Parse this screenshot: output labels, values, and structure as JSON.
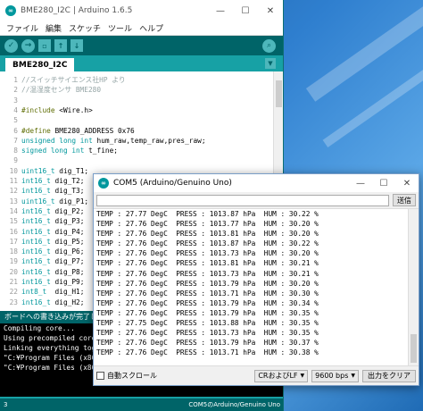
{
  "ide": {
    "title": "BME280_I2C | Arduino 1.6.5",
    "menu": [
      "ファイル",
      "編集",
      "スケッチ",
      "ツール",
      "ヘルプ"
    ],
    "tab_label": "BME280_I2C",
    "code_lines": [
      {
        "n": "1",
        "segs": [
          [
            "c",
            "//スイッチサイエンス社HP より"
          ]
        ]
      },
      {
        "n": "2",
        "segs": [
          [
            "c",
            "//温湿度センサ BME280"
          ]
        ]
      },
      {
        "n": "3",
        "segs": []
      },
      {
        "n": "4",
        "segs": [
          [
            "p",
            "#include"
          ],
          [
            "i",
            " <Wire.h>"
          ]
        ]
      },
      {
        "n": "5",
        "segs": []
      },
      {
        "n": "6",
        "segs": [
          [
            "p",
            "#define"
          ],
          [
            "i",
            " BME280_ADDRESS 0x76"
          ]
        ]
      },
      {
        "n": "7",
        "segs": [
          [
            "t",
            "unsigned long int"
          ],
          [
            "i",
            " hum_raw,temp_raw,pres_raw;"
          ]
        ]
      },
      {
        "n": "8",
        "segs": [
          [
            "t",
            "signed long int"
          ],
          [
            "i",
            " t_fine;"
          ]
        ]
      },
      {
        "n": "9",
        "segs": []
      },
      {
        "n": "10",
        "segs": [
          [
            "t",
            "uint16_t"
          ],
          [
            "i",
            " dig_T1;"
          ]
        ]
      },
      {
        "n": "11",
        "segs": [
          [
            "t",
            "int16_t"
          ],
          [
            "i",
            " dig_T2;"
          ]
        ]
      },
      {
        "n": "12",
        "segs": [
          [
            "t",
            "int16_t"
          ],
          [
            "i",
            " dig_T3;"
          ]
        ]
      },
      {
        "n": "13",
        "segs": [
          [
            "t",
            "uint16_t"
          ],
          [
            "i",
            " dig_P1;"
          ]
        ]
      },
      {
        "n": "14",
        "segs": [
          [
            "t",
            "int16_t"
          ],
          [
            "i",
            " dig_P2;"
          ]
        ]
      },
      {
        "n": "15",
        "segs": [
          [
            "t",
            "int16_t"
          ],
          [
            "i",
            " dig_P3;"
          ]
        ]
      },
      {
        "n": "16",
        "segs": [
          [
            "t",
            "int16_t"
          ],
          [
            "i",
            " dig_P4;"
          ]
        ]
      },
      {
        "n": "17",
        "segs": [
          [
            "t",
            "int16_t"
          ],
          [
            "i",
            " dig_P5;"
          ]
        ]
      },
      {
        "n": "18",
        "segs": [
          [
            "t",
            "int16_t"
          ],
          [
            "i",
            " dig_P6;"
          ]
        ]
      },
      {
        "n": "19",
        "segs": [
          [
            "t",
            "int16_t"
          ],
          [
            "i",
            " dig_P7;"
          ]
        ]
      },
      {
        "n": "20",
        "segs": [
          [
            "t",
            "int16_t"
          ],
          [
            "i",
            " dig_P8;"
          ]
        ]
      },
      {
        "n": "21",
        "segs": [
          [
            "t",
            "int16_t"
          ],
          [
            "i",
            " dig_P9;"
          ]
        ]
      },
      {
        "n": "22",
        "segs": [
          [
            "t",
            "int8_t"
          ],
          [
            "i",
            "  dig_H1;"
          ]
        ]
      },
      {
        "n": "23",
        "segs": [
          [
            "t",
            "int16_t"
          ],
          [
            "i",
            " dig_H2;"
          ]
        ]
      }
    ],
    "status_message": "ボードへの書き込みが完了しました。",
    "console_lines": [
      "Compiling core...",
      "Using precompiled core",
      "Linking everything together...",
      "\"C:¥Program Files (x86)¥Arduino¥hardware¥tools¥avr/bin/avr-gcc\" -w -Os",
      "\"C:¥Program Files (x86)¥Arduino¥hardware¥tools¥avr/bin/avr-objcopy\" -O"
    ],
    "bottom_line_number": "3",
    "bottom_board": "COM5のArduino/Genuino Uno"
  },
  "serial": {
    "title": "COM5 (Arduino/Genuino Uno)",
    "send_label": "送信",
    "output_lines": [
      "TEMP : 27.77 DegC  PRESS : 1013.87 hPa  HUM : 30.22 %",
      "TEMP : 27.76 DegC  PRESS : 1013.77 hPa  HUM : 30.20 %",
      "TEMP : 27.76 DegC  PRESS : 1013.81 hPa  HUM : 30.20 %",
      "TEMP : 27.76 DegC  PRESS : 1013.87 hPa  HUM : 30.22 %",
      "TEMP : 27.76 DegC  PRESS : 1013.73 hPa  HUM : 30.20 %",
      "TEMP : 27.76 DegC  PRESS : 1013.81 hPa  HUM : 30.21 %",
      "TEMP : 27.76 DegC  PRESS : 1013.73 hPa  HUM : 30.21 %",
      "TEMP : 27.76 DegC  PRESS : 1013.79 hPa  HUM : 30.20 %",
      "TEMP : 27.76 DegC  PRESS : 1013.71 hPa  HUM : 30.30 %",
      "TEMP : 27.76 DegC  PRESS : 1013.79 hPa  HUM : 30.34 %",
      "TEMP : 27.76 DegC  PRESS : 1013.79 hPa  HUM : 30.35 %",
      "TEMP : 27.75 DegC  PRESS : 1013.88 hPa  HUM : 30.35 %",
      "TEMP : 27.76 DegC  PRESS : 1013.73 hPa  HUM : 30.35 %",
      "TEMP : 27.76 DegC  PRESS : 1013.79 hPa  HUM : 30.37 %",
      "TEMP : 27.76 DegC  PRESS : 1013.71 hPa  HUM : 30.38 %"
    ],
    "autoscroll_label": "自動スクロール",
    "autoscroll_checked": false,
    "line_ending": "CRおよびLF",
    "baud": "9600 bps",
    "clear_label": "出力をクリア"
  },
  "colors": {
    "arduino_teal": "#17a1a5",
    "arduino_dark": "#006468",
    "comment": "#95a5a6",
    "preproc": "#5e6d03",
    "type": "#00979c"
  }
}
